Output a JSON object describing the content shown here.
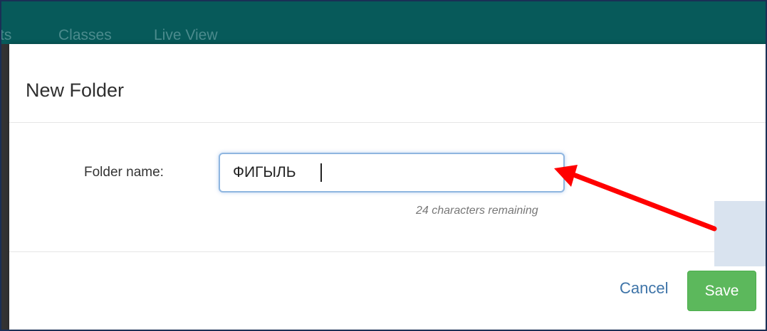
{
  "nav": {
    "items": [
      "ts",
      "Classes",
      "Live View"
    ]
  },
  "modal": {
    "title": "New Folder",
    "field_label": "Folder name:",
    "input_value": "ФИГЫЛЬ",
    "remaining_text": "24 characters remaining",
    "cancel_label": "Cancel",
    "save_label": "Save"
  },
  "colors": {
    "nav_bg": "#075a5a",
    "save_bg": "#5cb85c",
    "link": "#3e74a8",
    "arrow": "#ff0000"
  },
  "icons": {
    "annotation": "red-arrow-icon"
  }
}
